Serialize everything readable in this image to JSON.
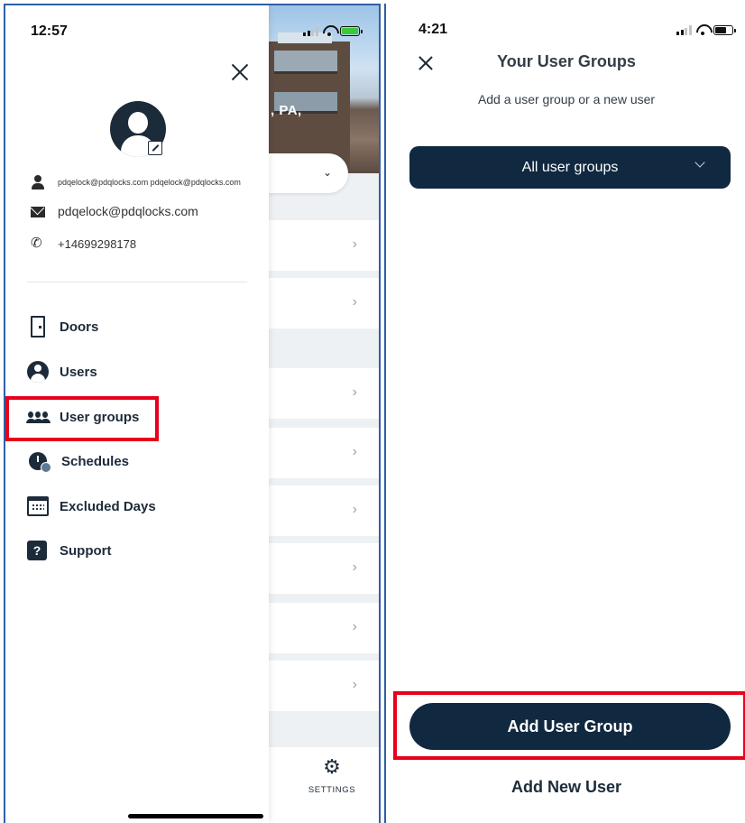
{
  "left_phone": {
    "status_bar": {
      "time": "12:57"
    },
    "background_app": {
      "city_fragment": ", PA,",
      "settings_label": "SETTINGS"
    },
    "drawer": {
      "profile": {
        "username": "pdqelock@pdqlocks.com pdqelock@pdqlocks.com",
        "email": "pdqelock@pdqlocks.com",
        "phone": "+14699298178"
      },
      "menu": [
        {
          "label": "Doors",
          "icon": "door-icon"
        },
        {
          "label": "Users",
          "icon": "user-circle-icon"
        },
        {
          "label": "User groups",
          "icon": "user-group-icon",
          "highlighted": true
        },
        {
          "label": "Schedules",
          "icon": "schedule-clock-icon"
        },
        {
          "label": "Excluded Days",
          "icon": "calendar-icon"
        },
        {
          "label": "Support",
          "icon": "help-icon"
        }
      ]
    }
  },
  "right_phone": {
    "status_bar": {
      "time": "4:21"
    },
    "title": "Your User Groups",
    "subtitle": "Add a user group or a new user",
    "group_select": {
      "value": "All user groups"
    },
    "primary_button": "Add User Group",
    "secondary_button": "Add New User"
  },
  "colors": {
    "navy": "#102840",
    "highlight_red": "#e8001c",
    "battery_charging": "#3cc83c",
    "frame_blue": "#2f5fa6"
  }
}
